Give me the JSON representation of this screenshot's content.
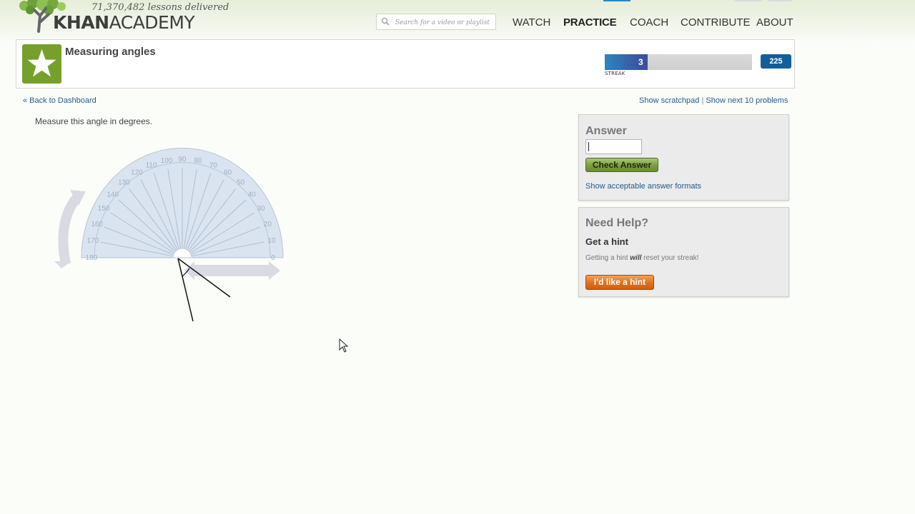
{
  "header": {
    "lessons_delivered": "71,370,482 lessons delivered",
    "brand_bold": "KHAN",
    "brand_light": "ACADEMY",
    "search_placeholder": "Search for a video or playlist",
    "search_icon": "search-icon",
    "nav": [
      {
        "label": "WATCH",
        "active": false
      },
      {
        "label": "PRACTICE",
        "active": true
      },
      {
        "label": "COACH",
        "active": false
      },
      {
        "label": "CONTRIBUTE",
        "active": false
      },
      {
        "label": "ABOUT",
        "active": false
      }
    ]
  },
  "exercise": {
    "title": "Measuring angles",
    "icon": "star-icon",
    "icon_color": "#76a02b",
    "streak_value": "3",
    "streak_label": "STREAK",
    "points": "225",
    "back_link": "« Back to Dashboard",
    "show_scratchpad": "Show scratchpad",
    "link_separator": "|",
    "show_next": "Show next 10 problems",
    "question": "Measure this angle in degrees."
  },
  "protractor": {
    "tick_labels": [
      "180",
      "170",
      "160",
      "150",
      "140",
      "130",
      "120",
      "110",
      "100",
      "90",
      "80",
      "70",
      "60",
      "50",
      "40",
      "30",
      "20",
      "10",
      "0"
    ],
    "rotate_handle_icon": "rotate-arrow-icon",
    "move_handle_icon": "move-arrow-icon"
  },
  "answer_panel": {
    "title": "Answer",
    "input_value": "",
    "check_button": "Check Answer",
    "formats_link": "Show acceptable answer formats"
  },
  "help_panel": {
    "title": "Need Help?",
    "hint_title": "Get a hint",
    "hint_note_before": "Getting a hint ",
    "hint_note_emph": "will",
    "hint_note_after": " reset your streak!",
    "hint_button": "I'd like a hint"
  },
  "colors": {
    "accent_green": "#76a02b",
    "streak_blue": "#2a86c2",
    "points_blue": "#125d9a",
    "link_blue": "#235b8c",
    "hint_orange": "#e0701c"
  }
}
